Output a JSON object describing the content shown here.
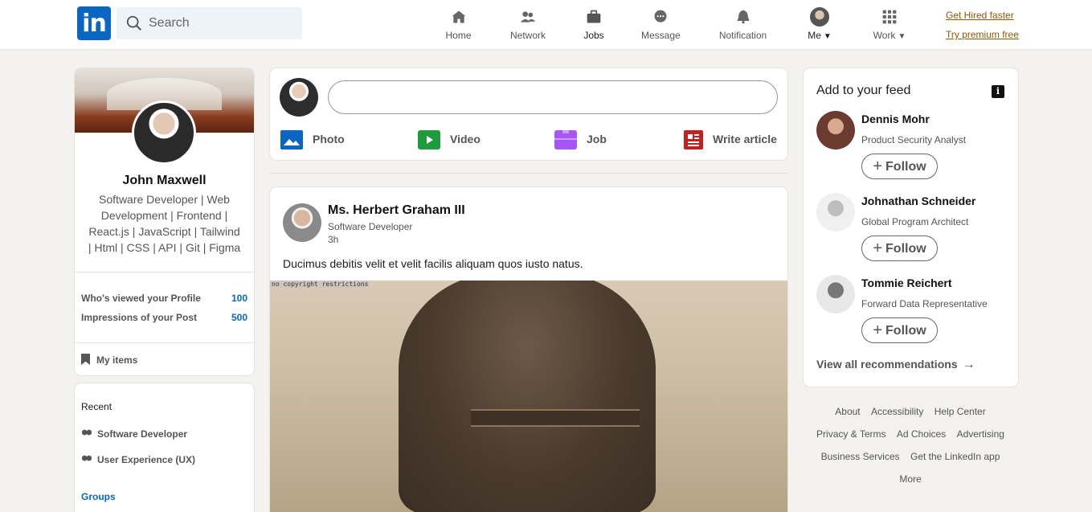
{
  "header": {
    "logo_text": "in",
    "search_placeholder": "Search",
    "nav": [
      {
        "label": "Home",
        "icon": "home-icon"
      },
      {
        "label": "Network",
        "icon": "network-icon"
      },
      {
        "label": "Jobs",
        "icon": "jobs-icon"
      },
      {
        "label": "Message",
        "icon": "message-icon"
      },
      {
        "label": "Notification",
        "icon": "bell-icon"
      },
      {
        "label": "Me",
        "icon": "avatar"
      },
      {
        "label": "Work",
        "icon": "grid-icon"
      }
    ],
    "premium_1": "Get Hired faster",
    "premium_2": "Try premium free"
  },
  "profile": {
    "name": "John Maxwell",
    "headline": "Software Developer | Web Development | Frontend | React.js | JavaScript | Tailwind | Html | CSS | API | Git | Figma",
    "stats": [
      {
        "label": "Who's viewed your Profile",
        "value": "100"
      },
      {
        "label": "Impressions of your Post",
        "value": "500"
      }
    ],
    "my_items": "My items"
  },
  "recent": {
    "title": "Recent",
    "items": [
      "Software Developer",
      "User Experience (UX)"
    ],
    "groups": "Groups"
  },
  "composer": {
    "actions": [
      {
        "label": "Photo",
        "color": "#0a66c2"
      },
      {
        "label": "Video",
        "color": "#1f9a3c"
      },
      {
        "label": "Job",
        "color": "#a855f7"
      },
      {
        "label": "Write article",
        "color": "#c3211f"
      }
    ]
  },
  "post": {
    "author": "Ms. Herbert Graham III",
    "title": "Software Developer",
    "time": "3h",
    "text": "Ducimus debitis velit et velit facilis aliquam quos iusto natus.",
    "image_label": "no copyright restrictions"
  },
  "feed": {
    "title": "Add to your feed",
    "follow_label": "Follow",
    "people": [
      {
        "name": "Dennis Mohr",
        "role": "Product Security Analyst"
      },
      {
        "name": "Johnathan Schneider",
        "role": "Global Program Architect"
      },
      {
        "name": "Tommie Reichert",
        "role": "Forward Data Representative"
      }
    ],
    "view_all": "View all recommendations"
  },
  "footer": {
    "row1": [
      "About",
      "Accessibility",
      "Help Center"
    ],
    "row2": [
      "Privacy & Terms",
      "Ad Choices",
      "Advertising"
    ],
    "row3": [
      "Business Services",
      "Get the LinkedIn app"
    ],
    "row4": [
      "More"
    ]
  }
}
